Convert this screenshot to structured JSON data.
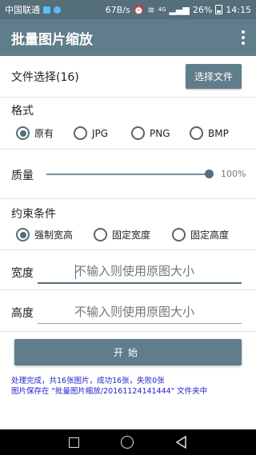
{
  "status_bar": {
    "carrier": "中国联通",
    "speed": "67B/s",
    "network": "4G",
    "battery": "26%",
    "time": "14:15"
  },
  "app_bar": {
    "title": "批量图片缩放",
    "menu_icon": "overflow-menu-icon"
  },
  "file_select": {
    "label": "文件选择(16)",
    "button_label": "选择文件"
  },
  "format": {
    "label": "格式",
    "options": [
      "原有",
      "JPG",
      "PNG",
      "BMP"
    ],
    "selected": "原有"
  },
  "quality": {
    "label": "质量",
    "value_text": "100%",
    "value_fraction": 1.0
  },
  "constraints": {
    "label": "约束条件",
    "options": [
      "强制宽高",
      "固定宽度",
      "固定高度"
    ],
    "selected": "强制宽高"
  },
  "width_field": {
    "label": "宽度",
    "placeholder": "不输入则使用原图大小",
    "value": ""
  },
  "height_field": {
    "label": "高度",
    "placeholder": "不输入则使用原图大小",
    "value": ""
  },
  "start_button": {
    "label": "开始"
  },
  "result": {
    "line1": "处理完成，共16张图片，成功16张，失败0张",
    "line2": "图片保存在 \"批量图片缩放/20161124141444\" 文件夹中"
  },
  "colors": {
    "status_bar": "#546e7a",
    "app_bar": "#607d8b",
    "accent": "#546e7a",
    "result_text": "#1e1ec8"
  }
}
